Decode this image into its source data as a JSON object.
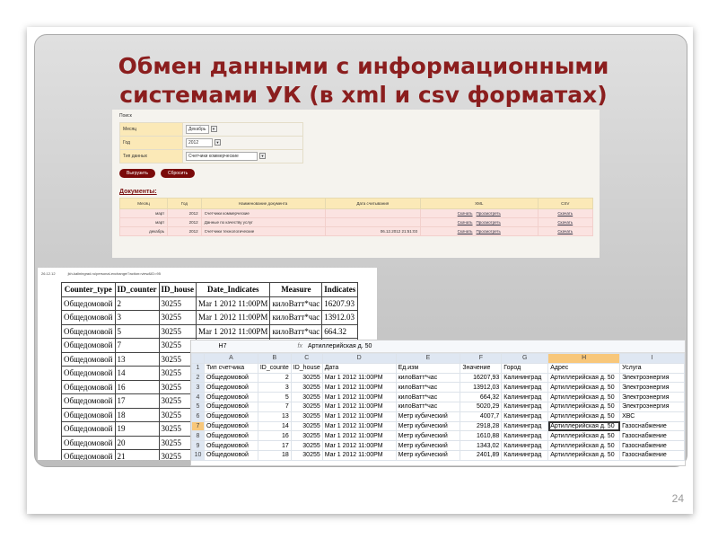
{
  "slide": {
    "title_line1": "Обмен данными с информационными",
    "title_line2": "системами УК (в xml и csv форматах)",
    "page_number": "24"
  },
  "web": {
    "search_label": "Поиск",
    "fields": [
      {
        "label": "Месяц",
        "value": "Декабрь"
      },
      {
        "label": "Год",
        "value": "2012"
      },
      {
        "label": "Тип данных",
        "value": "Счетчики коммерческие"
      }
    ],
    "export_button": "Выгрузить",
    "reset_button": "Сбросить",
    "documents_heading": "Документы:",
    "columns": [
      "Месяц",
      "Год",
      "Наименование документа",
      "Дата считывания",
      "XML",
      "CSV"
    ],
    "rows": [
      {
        "month": "март",
        "year": "2012",
        "name": "Счетчики коммерческие",
        "date": "",
        "download": "Скачать",
        "view": "Просмотреть",
        "csv": "Скачать"
      },
      {
        "month": "март",
        "year": "2012",
        "name": "Данные по качеству услуг",
        "date": "",
        "download": "Скачать",
        "view": "Просмотреть",
        "csv": "Скачать"
      },
      {
        "month": "декабрь",
        "year": "2012",
        "name": "Счетчики технологические",
        "date": "06.12.2012 21:51:03",
        "download": "Скачать",
        "view": "Просмотреть",
        "csv": "Скачать"
      }
    ]
  },
  "printed": {
    "date": "26.12.12",
    "url": "jkh-kaliningrad.ru/personal-exchange/?action=view&ID=95",
    "columns": [
      "Counter_type",
      "ID_counter",
      "ID_house",
      "Date_Indicates",
      "Measure",
      "Indicates"
    ],
    "rows": [
      [
        "Общедомовой",
        "2",
        "30255",
        "Mar 1 2012 11:00PM",
        "килоВатт*час",
        "16207.93"
      ],
      [
        "Общедомовой",
        "3",
        "30255",
        "Mar 1 2012 11:00PM",
        "килоВатт*час",
        "13912.03"
      ],
      [
        "Общедомовой",
        "5",
        "30255",
        "Mar 1 2012 11:00PM",
        "килоВатт*час",
        "664.32"
      ],
      [
        "Общедомовой",
        "7",
        "30255"
      ],
      [
        "Общедомовой",
        "13",
        "30255"
      ],
      [
        "Общедомовой",
        "14",
        "30255"
      ],
      [
        "Общедомовой",
        "16",
        "30255"
      ],
      [
        "Общедомовой",
        "17",
        "30255"
      ],
      [
        "Общедомовой",
        "18",
        "30255"
      ],
      [
        "Общедомовой",
        "19",
        "30255"
      ],
      [
        "Общедомовой",
        "20",
        "30255"
      ],
      [
        "Общедомовой",
        "21",
        "30255"
      ]
    ]
  },
  "excel": {
    "cell_ref": "H7",
    "fx": "fx",
    "formula_value": "Артиллерийская д. 50",
    "col_letters": [
      "A",
      "B",
      "C",
      "D",
      "E",
      "F",
      "G",
      "H",
      "I"
    ],
    "rows": [
      [
        "1",
        "Тип счетчика",
        "ID_counte",
        "ID_house",
        "Дата",
        "Ед.изм",
        "Значение",
        "Город",
        "Адрес",
        "Услуга"
      ],
      [
        "2",
        "Общедомовой",
        "2",
        "30255",
        "Mar 1 2012 11:00PM",
        "килоВатт*час",
        "16207,93",
        "Калининград",
        "Артиллерийская д. 50",
        "Электроэнергия"
      ],
      [
        "3",
        "Общедомовой",
        "3",
        "30255",
        "Mar 1 2012 11:00PM",
        "килоВатт*час",
        "13912,03",
        "Калининград",
        "Артиллерийская д. 50",
        "Электроэнергия"
      ],
      [
        "4",
        "Общедомовой",
        "5",
        "30255",
        "Mar 1 2012 11:00PM",
        "килоВатт*час",
        "664,32",
        "Калининград",
        "Артиллерийская д. 50",
        "Электроэнергия"
      ],
      [
        "5",
        "Общедомовой",
        "7",
        "30255",
        "Mar 1 2012 11:00PM",
        "килоВатт*час",
        "5020,29",
        "Калининград",
        "Артиллерийская д. 50",
        "Электроэнергия"
      ],
      [
        "6",
        "Общедомовой",
        "13",
        "30255",
        "Mar 1 2012 11:00PM",
        "Метр кубический",
        "4007,7",
        "Калининград",
        "Артиллерийская д. 50",
        "ХВС"
      ],
      [
        "7",
        "Общедомовой",
        "14",
        "30255",
        "Mar 1 2012 11:00PM",
        "Метр кубический",
        "2918,28",
        "Калининград",
        "Артиллерийская д. 50",
        "Газоснабжение"
      ],
      [
        "8",
        "Общедомовой",
        "16",
        "30255",
        "Mar 1 2012 11:00PM",
        "Метр кубический",
        "1610,88",
        "Калининград",
        "Артиллерийская д. 50",
        "Газоснабжение"
      ],
      [
        "9",
        "Общедомовой",
        "17",
        "30255",
        "Mar 1 2012 11:00PM",
        "Метр кубический",
        "1343,02",
        "Калининград",
        "Артиллерийская д. 50",
        "Газоснабжение"
      ],
      [
        "10",
        "Общедомовой",
        "18",
        "30255",
        "Mar 1 2012 11:00PM",
        "Метр кубический",
        "2401,89",
        "Калининград",
        "Артиллерийская д. 50",
        "Газоснабжение"
      ]
    ]
  }
}
